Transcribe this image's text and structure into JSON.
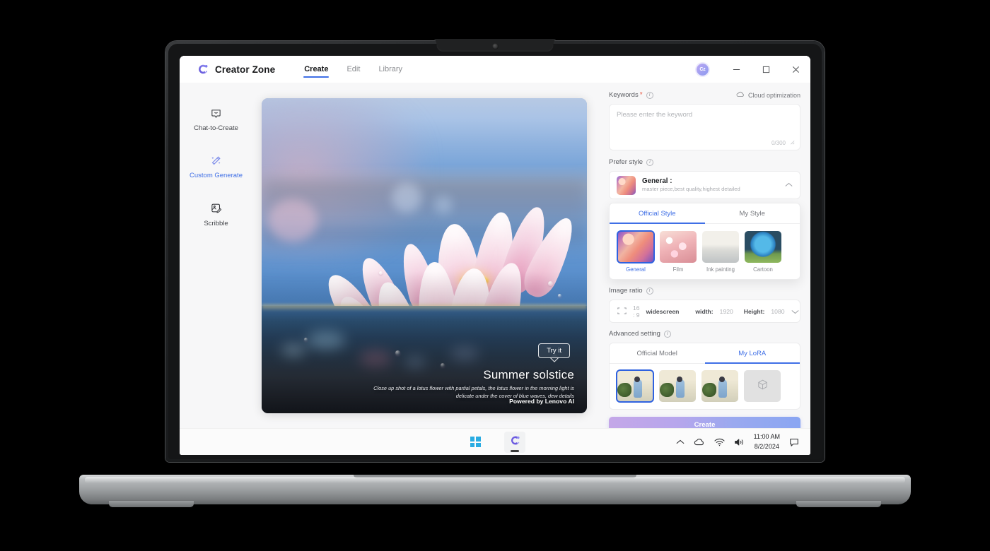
{
  "app": {
    "brand_name": "Creator Zone",
    "brand_logo_icon": "creator-zone-logo",
    "nav": [
      {
        "label": "Create",
        "active": true
      },
      {
        "label": "Edit",
        "active": false
      },
      {
        "label": "Library",
        "active": false
      }
    ],
    "avatar_initials": "Cz",
    "window_controls": {
      "minimize_icon": "minimize-icon",
      "maximize_icon": "maximize-icon",
      "close_icon": "close-icon"
    }
  },
  "sidebar": {
    "items": [
      {
        "label": "Chat-to-Create",
        "icon": "chat-bubble-icon",
        "active": false
      },
      {
        "label": "Custom Generate",
        "icon": "magic-wand-icon",
        "active": true
      },
      {
        "label": "Scribble",
        "icon": "scribble-image-icon",
        "active": false
      }
    ]
  },
  "preview": {
    "try_it_label": "Try it",
    "title": "Summer solstice",
    "description": "Close up shot of a lotus flower with partial petals, the lotus flower in the morning light is delicate under the cover of blue waves, dew details",
    "powered_by": "Powered by  Lenovo AI"
  },
  "panel": {
    "keywords": {
      "label": "Keywords",
      "required_mark": "*",
      "info_icon": "info-icon",
      "cloud_optimization_label": "Cloud optimization",
      "cloud_icon": "cloud-icon",
      "placeholder": "Please enter the keyword",
      "value": "",
      "counter": "0/300",
      "resize_icon": "resize-handle-icon"
    },
    "prefer_style": {
      "label": "Prefer style",
      "info_icon": "info-icon",
      "selected_name": "General :",
      "selected_sub": "master piece,best quality,highest detailed",
      "chevron_icon": "chevron-up-icon",
      "tabs": [
        {
          "label": "Official Style",
          "active": true
        },
        {
          "label": "My Style",
          "active": false
        }
      ],
      "styles": [
        {
          "label": "General",
          "selected": true,
          "thumb": "th-general"
        },
        {
          "label": "Film",
          "selected": false,
          "thumb": "th-film"
        },
        {
          "label": "Ink painting",
          "selected": false,
          "thumb": "th-ink"
        },
        {
          "label": "Cartoon",
          "selected": false,
          "thumb": "th-cartoon"
        }
      ]
    },
    "image_ratio": {
      "label": "Image ratio",
      "info_icon": "info-icon",
      "ratio_icon": "crop-frame-icon",
      "ratio": "16 : 9",
      "ratio_name": "widescreen",
      "width_label": "width:",
      "width_value": "1920",
      "height_label": "Height:",
      "height_value": "1080",
      "chevron_icon": "chevron-down-icon"
    },
    "advanced_setting": {
      "label": "Advanced setting",
      "info_icon": "info-icon",
      "tabs": [
        {
          "label": "Official Model",
          "active": false
        },
        {
          "label": "My LoRA",
          "active": true
        }
      ],
      "models": [
        {
          "selected": true
        },
        {
          "selected": false
        },
        {
          "selected": false
        }
      ],
      "add_model_icon": "cube-add-icon"
    },
    "create_button_label": "Create",
    "create_button_gradient": [
      "#c4a7e8",
      "#8aa6f2"
    ]
  },
  "taskbar": {
    "start_icon": "windows-start-icon",
    "app_icon": "creator-zone-taskbar-icon",
    "tray": {
      "chevron_icon": "show-hidden-icons-chevron",
      "cloud_icon": "cloud-icon",
      "wifi_icon": "wifi-icon",
      "volume_icon": "volume-icon",
      "notification_icon": "notification-chat-icon"
    },
    "time": "11:00 AM",
    "date": "8/2/2024"
  },
  "theme": {
    "accent": "#3f6fe6",
    "selected_outline": "#2f62e0",
    "required_red": "#e8543f"
  }
}
